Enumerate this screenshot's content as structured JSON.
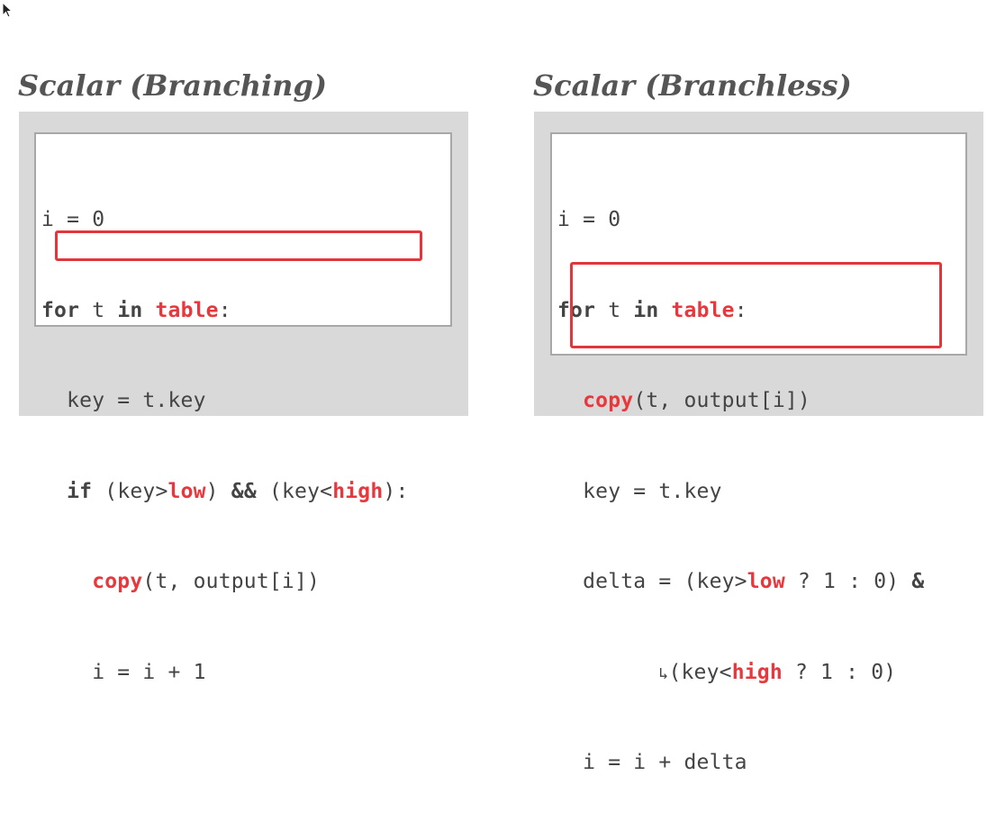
{
  "left_panel": {
    "title": "Scalar (Branching)",
    "code": {
      "l1_text": "i = 0",
      "l2_kw_for": "for",
      "l2_t": " t ",
      "l2_kw_in": "in",
      "l2_space": " ",
      "l2_table": "table",
      "l2_colon": ":",
      "l3_text": "  key = t.key",
      "l4_indent": "  ",
      "l4_kw_if": "if",
      "l4_a": " (key>",
      "l4_low": "low",
      "l4_b": ") ",
      "l4_and": "&&",
      "l4_c": " (key<",
      "l4_high": "high",
      "l4_d": "):",
      "l5_indent": "    ",
      "l5_copy": "copy",
      "l5_args": "(t, output[i])",
      "l6_text": "    i = i + 1"
    }
  },
  "right_panel": {
    "title": "Scalar (Branchless)",
    "code": {
      "l1_text": "i = 0",
      "l2_kw_for": "for",
      "l2_t": " t ",
      "l2_kw_in": "in",
      "l2_space": " ",
      "l2_table": "table",
      "l2_colon": ":",
      "l3_indent": "  ",
      "l3_copy": "copy",
      "l3_args": "(t, output[i])",
      "l4_text": "  key = t.key",
      "l5_a": "  delta = (key>",
      "l5_low": "low",
      "l5_b": " ? 1 : 0) ",
      "l5_amp": "&",
      "l6_indent": "        ",
      "l6_wrap": "↳",
      "l6_a": "(key<",
      "l6_high": "high",
      "l6_b": " ? 1 : 0)",
      "l7_text": "  i = i + delta"
    }
  },
  "colors": {
    "accent_red": "#e8383d",
    "panel_gray": "#d9d9d9",
    "code_text": "#444444"
  }
}
